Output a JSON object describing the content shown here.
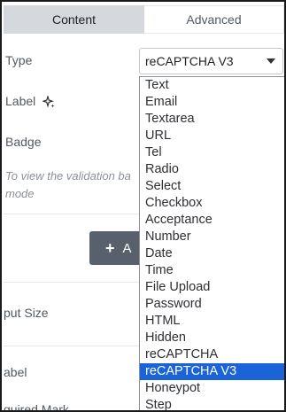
{
  "tabs": {
    "content": "Content",
    "advanced": "Advanced"
  },
  "fields": {
    "type_label": "Type",
    "type_value": "reCAPTCHA V3",
    "label_label": "Label",
    "badge_label": "Badge",
    "hint_text": "To view the validation ba mode",
    "add_button_label": "A",
    "input_size_label": "put Size",
    "label2_label": "abel",
    "required_mark_label": "quired Mark"
  },
  "dropdown": {
    "options": [
      "Text",
      "Email",
      "Textarea",
      "URL",
      "Tel",
      "Radio",
      "Select",
      "Checkbox",
      "Acceptance",
      "Number",
      "Date",
      "Time",
      "File Upload",
      "Password",
      "HTML",
      "Hidden",
      "reCAPTCHA",
      "reCAPTCHA V3",
      "Honeypot",
      "Step"
    ],
    "selected": "reCAPTCHA V3"
  },
  "icons": {
    "sparkle": "sparkle-icon",
    "caret": "caret-down-icon",
    "plus": "plus-icon"
  },
  "colors": {
    "selected_option": "#1a63d8",
    "add_button": "#58616b",
    "active_tab": "#d5d8dc"
  }
}
